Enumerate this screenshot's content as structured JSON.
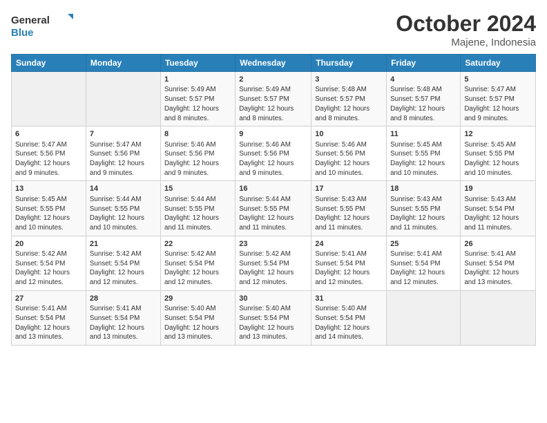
{
  "header": {
    "logo_line1": "General",
    "logo_line2": "Blue",
    "month": "October 2024",
    "location": "Majene, Indonesia"
  },
  "weekdays": [
    "Sunday",
    "Monday",
    "Tuesday",
    "Wednesday",
    "Thursday",
    "Friday",
    "Saturday"
  ],
  "weeks": [
    [
      {
        "day": "",
        "info": ""
      },
      {
        "day": "",
        "info": ""
      },
      {
        "day": "1",
        "info": "Sunrise: 5:49 AM\nSunset: 5:57 PM\nDaylight: 12 hours\nand 8 minutes."
      },
      {
        "day": "2",
        "info": "Sunrise: 5:49 AM\nSunset: 5:57 PM\nDaylight: 12 hours\nand 8 minutes."
      },
      {
        "day": "3",
        "info": "Sunrise: 5:48 AM\nSunset: 5:57 PM\nDaylight: 12 hours\nand 8 minutes."
      },
      {
        "day": "4",
        "info": "Sunrise: 5:48 AM\nSunset: 5:57 PM\nDaylight: 12 hours\nand 8 minutes."
      },
      {
        "day": "5",
        "info": "Sunrise: 5:47 AM\nSunset: 5:57 PM\nDaylight: 12 hours\nand 9 minutes."
      }
    ],
    [
      {
        "day": "6",
        "info": "Sunrise: 5:47 AM\nSunset: 5:56 PM\nDaylight: 12 hours\nand 9 minutes."
      },
      {
        "day": "7",
        "info": "Sunrise: 5:47 AM\nSunset: 5:56 PM\nDaylight: 12 hours\nand 9 minutes."
      },
      {
        "day": "8",
        "info": "Sunrise: 5:46 AM\nSunset: 5:56 PM\nDaylight: 12 hours\nand 9 minutes."
      },
      {
        "day": "9",
        "info": "Sunrise: 5:46 AM\nSunset: 5:56 PM\nDaylight: 12 hours\nand 9 minutes."
      },
      {
        "day": "10",
        "info": "Sunrise: 5:46 AM\nSunset: 5:56 PM\nDaylight: 12 hours\nand 10 minutes."
      },
      {
        "day": "11",
        "info": "Sunrise: 5:45 AM\nSunset: 5:55 PM\nDaylight: 12 hours\nand 10 minutes."
      },
      {
        "day": "12",
        "info": "Sunrise: 5:45 AM\nSunset: 5:55 PM\nDaylight: 12 hours\nand 10 minutes."
      }
    ],
    [
      {
        "day": "13",
        "info": "Sunrise: 5:45 AM\nSunset: 5:55 PM\nDaylight: 12 hours\nand 10 minutes."
      },
      {
        "day": "14",
        "info": "Sunrise: 5:44 AM\nSunset: 5:55 PM\nDaylight: 12 hours\nand 10 minutes."
      },
      {
        "day": "15",
        "info": "Sunrise: 5:44 AM\nSunset: 5:55 PM\nDaylight: 12 hours\nand 11 minutes."
      },
      {
        "day": "16",
        "info": "Sunrise: 5:44 AM\nSunset: 5:55 PM\nDaylight: 12 hours\nand 11 minutes."
      },
      {
        "day": "17",
        "info": "Sunrise: 5:43 AM\nSunset: 5:55 PM\nDaylight: 12 hours\nand 11 minutes."
      },
      {
        "day": "18",
        "info": "Sunrise: 5:43 AM\nSunset: 5:55 PM\nDaylight: 12 hours\nand 11 minutes."
      },
      {
        "day": "19",
        "info": "Sunrise: 5:43 AM\nSunset: 5:54 PM\nDaylight: 12 hours\nand 11 minutes."
      }
    ],
    [
      {
        "day": "20",
        "info": "Sunrise: 5:42 AM\nSunset: 5:54 PM\nDaylight: 12 hours\nand 12 minutes."
      },
      {
        "day": "21",
        "info": "Sunrise: 5:42 AM\nSunset: 5:54 PM\nDaylight: 12 hours\nand 12 minutes."
      },
      {
        "day": "22",
        "info": "Sunrise: 5:42 AM\nSunset: 5:54 PM\nDaylight: 12 hours\nand 12 minutes."
      },
      {
        "day": "23",
        "info": "Sunrise: 5:42 AM\nSunset: 5:54 PM\nDaylight: 12 hours\nand 12 minutes."
      },
      {
        "day": "24",
        "info": "Sunrise: 5:41 AM\nSunset: 5:54 PM\nDaylight: 12 hours\nand 12 minutes."
      },
      {
        "day": "25",
        "info": "Sunrise: 5:41 AM\nSunset: 5:54 PM\nDaylight: 12 hours\nand 12 minutes."
      },
      {
        "day": "26",
        "info": "Sunrise: 5:41 AM\nSunset: 5:54 PM\nDaylight: 12 hours\nand 13 minutes."
      }
    ],
    [
      {
        "day": "27",
        "info": "Sunrise: 5:41 AM\nSunset: 5:54 PM\nDaylight: 12 hours\nand 13 minutes."
      },
      {
        "day": "28",
        "info": "Sunrise: 5:41 AM\nSunset: 5:54 PM\nDaylight: 12 hours\nand 13 minutes."
      },
      {
        "day": "29",
        "info": "Sunrise: 5:40 AM\nSunset: 5:54 PM\nDaylight: 12 hours\nand 13 minutes."
      },
      {
        "day": "30",
        "info": "Sunrise: 5:40 AM\nSunset: 5:54 PM\nDaylight: 12 hours\nand 13 minutes."
      },
      {
        "day": "31",
        "info": "Sunrise: 5:40 AM\nSunset: 5:54 PM\nDaylight: 12 hours\nand 14 minutes."
      },
      {
        "day": "",
        "info": ""
      },
      {
        "day": "",
        "info": ""
      }
    ]
  ]
}
